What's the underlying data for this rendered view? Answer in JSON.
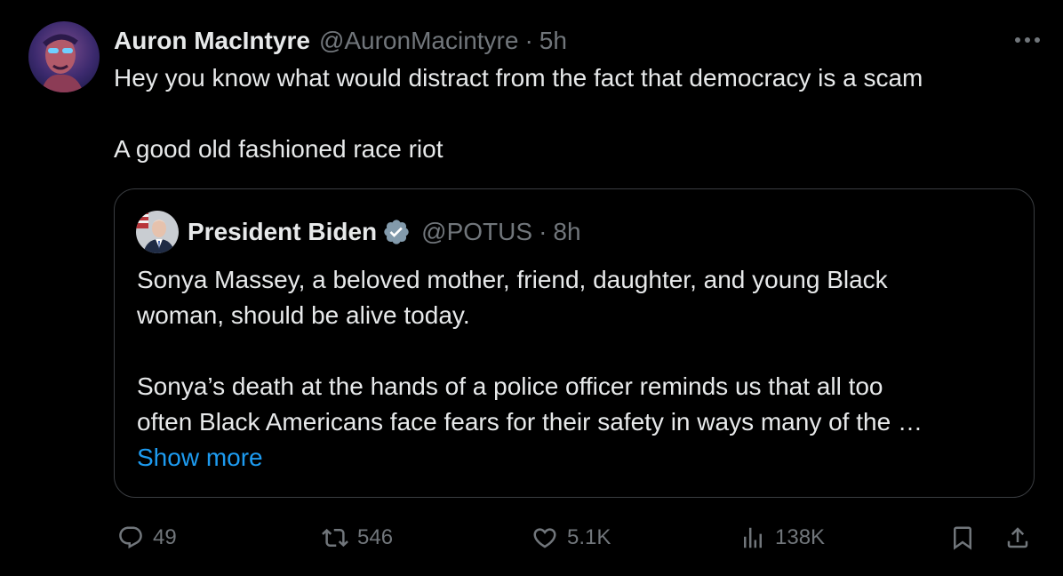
{
  "tweet": {
    "author": {
      "display_name": "Auron MacIntyre",
      "handle": "@AuronMacintyre",
      "timestamp": "5h"
    },
    "separator": "·",
    "text_lines": [
      "Hey you know what would distract from the fact that democracy is a scam",
      "A good old fashioned race riot"
    ],
    "more_icon": "more-horizontal-icon"
  },
  "quote": {
    "author": {
      "display_name": "President Biden",
      "handle": "@POTUS",
      "timestamp": "8h",
      "verified_icon": "verified-badge-icon"
    },
    "separator": "·",
    "paragraph1": [
      "Sonya Massey, a beloved mother, friend, daughter, and young Black",
      "woman, should be alive today."
    ],
    "paragraph2": [
      "Sonya’s death at the hands of a police officer reminds us that all too",
      "often Black Americans face fears for their safety in ways many of the …"
    ],
    "show_more": "Show more"
  },
  "actions": {
    "reply": {
      "icon": "reply-icon",
      "count": "49"
    },
    "retweet": {
      "icon": "retweet-icon",
      "count": "546"
    },
    "like": {
      "icon": "heart-icon",
      "count": "5.1K"
    },
    "views": {
      "icon": "views-icon",
      "count": "138K"
    },
    "bookmark": {
      "icon": "bookmark-icon"
    },
    "share": {
      "icon": "share-icon"
    }
  },
  "colors": {
    "background": "#000000",
    "text_primary": "#e7e9ea",
    "text_secondary": "#71767b",
    "link": "#1d9bf0",
    "border": "#3a3d41",
    "verified_badge": "#829aab"
  }
}
